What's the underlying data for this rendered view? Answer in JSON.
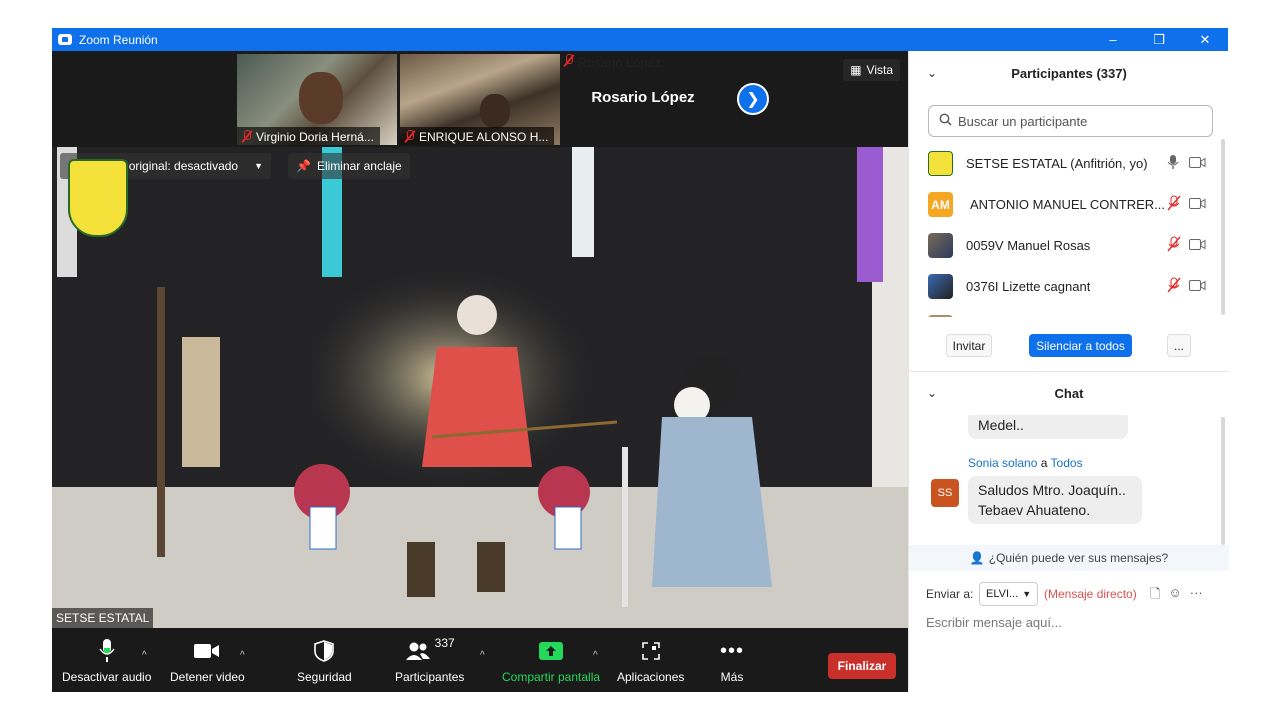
{
  "window": {
    "title": "Zoom Reunión",
    "controls": [
      "–",
      "❐",
      "✕"
    ]
  },
  "thumbnails": [
    {
      "name": "Virginio Doria Herná..."
    },
    {
      "name": "ENRIQUE ALONSO H..."
    },
    {
      "name": "Rosario López"
    }
  ],
  "name_card": "Rosario López",
  "vista_label": "Vista",
  "main_video": {
    "original_sound": "Sonido original: desactivado",
    "unpin": "Eliminar anclaje",
    "speaker_tag": "SETSE ESTATAL"
  },
  "toolbar": {
    "audio": "Desactivar audio",
    "video": "Detener video",
    "security": "Seguridad",
    "participants": "Participantes",
    "participants_count": "337",
    "share": "Compartir pantalla",
    "apps": "Aplicaciones",
    "more": "Más",
    "end": "Finalizar"
  },
  "participants_panel": {
    "title": "Participantes (337)",
    "search_placeholder": "Buscar un participante",
    "rows": [
      {
        "name": "SETSE ESTATAL (Anfitrión, yo)",
        "avatar": "logo",
        "muted": false
      },
      {
        "name": "ANTONIO MANUEL CONTRER...",
        "avatar": "AM",
        "avatar_color": "#f5a623",
        "muted": true
      },
      {
        "name": "0059V Manuel Rosas",
        "avatar": "photo",
        "muted": true
      },
      {
        "name": "0376I Lizette cagnant",
        "avatar": "photo",
        "muted": true
      }
    ],
    "invite": "Invitar",
    "mute_all": "Silenciar a todos",
    "more": "..."
  },
  "chat_panel": {
    "title": "Chat",
    "prev_message_tail": "Medel..",
    "message": {
      "sender": "Sonia solano",
      "connector": "a",
      "recipient": "Todos",
      "initials": "SS",
      "text_line1": "Saludos Mtro. Joaquín..",
      "text_line2": "Tebaev Ahuateno."
    },
    "who_can_see": "¿Quién puede ver sus mensajes?",
    "send_to_label": "Enviar a:",
    "send_to_value": "ELVI...",
    "direct_message": "(Mensaje directo)",
    "input_placeholder": "Escribir mensaje aquí..."
  },
  "colors": {
    "zoom_blue": "#0e71eb",
    "end_red": "#c9302c",
    "share_green": "#23d959",
    "muted_red": "#e02828"
  }
}
